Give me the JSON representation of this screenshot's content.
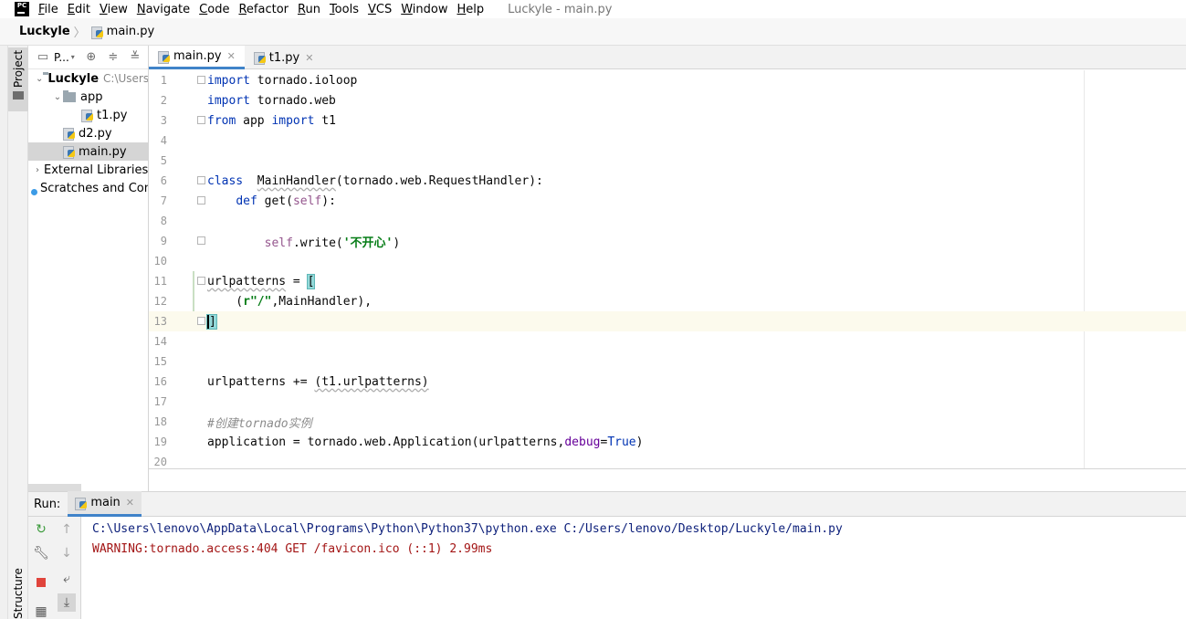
{
  "app": {
    "logo_text": "PC",
    "window_title": "Luckyle - main.py"
  },
  "menu": [
    {
      "mnemonic": "F",
      "rest": "ile"
    },
    {
      "mnemonic": "E",
      "rest": "dit"
    },
    {
      "mnemonic": "V",
      "rest": "iew"
    },
    {
      "mnemonic": "N",
      "rest": "avigate"
    },
    {
      "mnemonic": "C",
      "rest": "ode"
    },
    {
      "mnemonic": "R",
      "rest": "efactor"
    },
    {
      "mnemonic": "R",
      "rest": "un"
    },
    {
      "mnemonic": "T",
      "rest": "ools"
    },
    {
      "mnemonic": "V",
      "rest": "CS"
    },
    {
      "mnemonic": "W",
      "rest": "indow"
    },
    {
      "mnemonic": "H",
      "rest": "elp"
    }
  ],
  "breadcrumb": {
    "project": "Luckyle",
    "file": "main.py"
  },
  "side_tabs": {
    "project": "Project",
    "structure": "Structure"
  },
  "project_panel": {
    "view_label": "P...",
    "tree": [
      {
        "label": "Luckyle",
        "path": "C:\\Users\\lenovo\\Desktop\\Luckyle",
        "type": "folder",
        "expanded": true,
        "bold": true
      },
      {
        "label": "app",
        "type": "folder",
        "expanded": true
      },
      {
        "label": "t1.py",
        "type": "python"
      },
      {
        "label": "d2.py",
        "type": "python"
      },
      {
        "label": "main.py",
        "type": "python",
        "selected": true
      },
      {
        "label": "External Libraries",
        "type": "library",
        "expanded": false
      },
      {
        "label": "Scratches and Consoles",
        "type": "scratch"
      }
    ]
  },
  "editor_tabs": [
    {
      "label": "main.py",
      "active": true
    },
    {
      "label": "t1.py",
      "active": false
    }
  ],
  "editor": {
    "current_line": 13,
    "lines": [
      {
        "n": "1",
        "t": [
          [
            "kw",
            "import"
          ],
          [
            "",
            "  tornado.ioloop"
          ]
        ]
      },
      {
        "n": "2",
        "t": [
          [
            "kw",
            "import"
          ],
          [
            "",
            "  tornado.web"
          ]
        ]
      },
      {
        "n": "3",
        "t": [
          [
            "kw",
            "from"
          ],
          [
            "",
            "  app "
          ],
          [
            "kw",
            "import"
          ],
          [
            "",
            "  t1"
          ]
        ]
      },
      {
        "n": "4",
        "t": []
      },
      {
        "n": "5",
        "t": []
      },
      {
        "n": "6",
        "t": [
          [
            "kw",
            "class"
          ],
          [
            "",
            "  "
          ],
          [
            "wavy",
            "MainHandler"
          ],
          [
            "",
            "(tornado.web.RequestHandler):"
          ]
        ]
      },
      {
        "n": "7",
        "t": [
          [
            "",
            "    "
          ],
          [
            "kw",
            "def"
          ],
          [
            "",
            "  get("
          ],
          [
            "slf",
            "self"
          ],
          [
            "",
            "):"
          ]
        ]
      },
      {
        "n": "8",
        "t": []
      },
      {
        "n": "9",
        "t": [
          [
            "",
            "        "
          ],
          [
            "slf",
            "self"
          ],
          [
            "",
            ".write("
          ],
          [
            "str",
            "'不开心'"
          ],
          [
            "",
            ")"
          ]
        ]
      },
      {
        "n": "10",
        "t": []
      },
      {
        "n": "11",
        "t": [
          [
            "wavy",
            "urlpatterns"
          ],
          [
            "",
            " = "
          ],
          [
            "brk",
            "["
          ]
        ]
      },
      {
        "n": "12",
        "t": [
          [
            "",
            "    ("
          ],
          [
            "str",
            "r\"/\""
          ],
          [
            "",
            ",MainHandler),"
          ]
        ]
      },
      {
        "n": "13",
        "t": [
          [
            "brk caret",
            "]"
          ]
        ]
      },
      {
        "n": "14",
        "t": []
      },
      {
        "n": "15",
        "t": []
      },
      {
        "n": "16",
        "t": [
          [
            "",
            "urlpatterns += "
          ],
          [
            "wavy",
            "(t1.urlpatterns)"
          ]
        ]
      },
      {
        "n": "17",
        "t": []
      },
      {
        "n": "18",
        "t": [
          [
            "cm",
            "#创建tornado实例"
          ]
        ]
      },
      {
        "n": "19",
        "t": [
          [
            "",
            "application = tornado.web.Application(urlpatterns,"
          ],
          [
            "kwarg",
            "debug"
          ],
          [
            "",
            "="
          ],
          [
            "kw",
            "True"
          ],
          [
            "",
            ")"
          ]
        ]
      },
      {
        "n": "20",
        "t": []
      }
    ]
  },
  "run_panel": {
    "label": "Run:",
    "tab": "main",
    "console": {
      "command": "C:\\Users\\lenovo\\AppData\\Local\\Programs\\Python\\Python37\\python.exe C:/Users/lenovo/Desktop/Luckyle/main.py",
      "warning": "WARNING:tornado.access:404 GET /favicon.ico (::1) 2.99ms"
    }
  },
  "colors": {
    "keyword": "#0033b3",
    "string": "#067d17",
    "self": "#94558d",
    "comment": "#8c8c8c",
    "kwarg": "#660099",
    "warning": "#a31515",
    "active_tab_accent": "#4083c9"
  }
}
